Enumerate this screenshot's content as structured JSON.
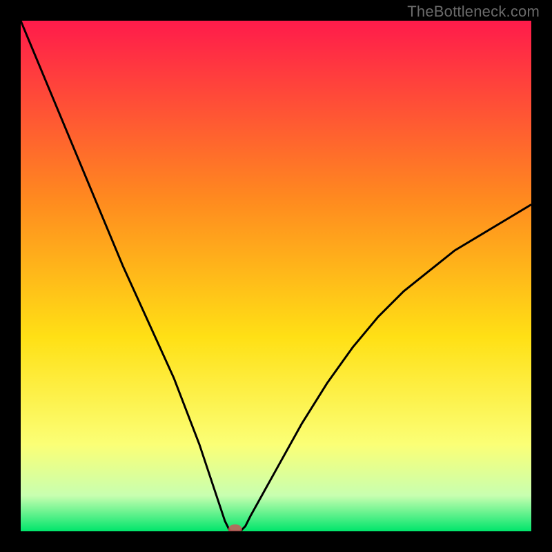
{
  "watermark": "TheBottleneck.com",
  "colors": {
    "frame": "#000000",
    "gradient_top": "#ff1b4b",
    "gradient_mid1": "#ff8a1f",
    "gradient_mid2": "#ffe015",
    "gradient_mid3": "#fbff76",
    "gradient_mid4": "#c8ffb0",
    "gradient_bottom": "#00e56b",
    "curve": "#000000",
    "marker": "#c85a5a"
  },
  "chart_data": {
    "type": "line",
    "title": "",
    "xlabel": "",
    "ylabel": "",
    "xlim": [
      0,
      100
    ],
    "ylim": [
      0,
      100
    ],
    "x": [
      0,
      5,
      10,
      15,
      20,
      25,
      30,
      35,
      38,
      40,
      41,
      42,
      43,
      44,
      45,
      50,
      55,
      60,
      65,
      70,
      75,
      80,
      85,
      90,
      95,
      100
    ],
    "values": [
      100,
      88,
      76,
      64,
      52,
      41,
      30,
      17,
      8,
      2,
      0,
      0,
      0,
      1,
      3,
      12,
      21,
      29,
      36,
      42,
      47,
      51,
      55,
      58,
      61,
      64
    ],
    "marker": {
      "x": 42,
      "y": 0
    },
    "notes": "V-shaped bottleneck curve; minimum (optimal match) near x≈42 where bottleneck≈0. Values estimated from pixel positions on a 0–100 normalized axis."
  }
}
